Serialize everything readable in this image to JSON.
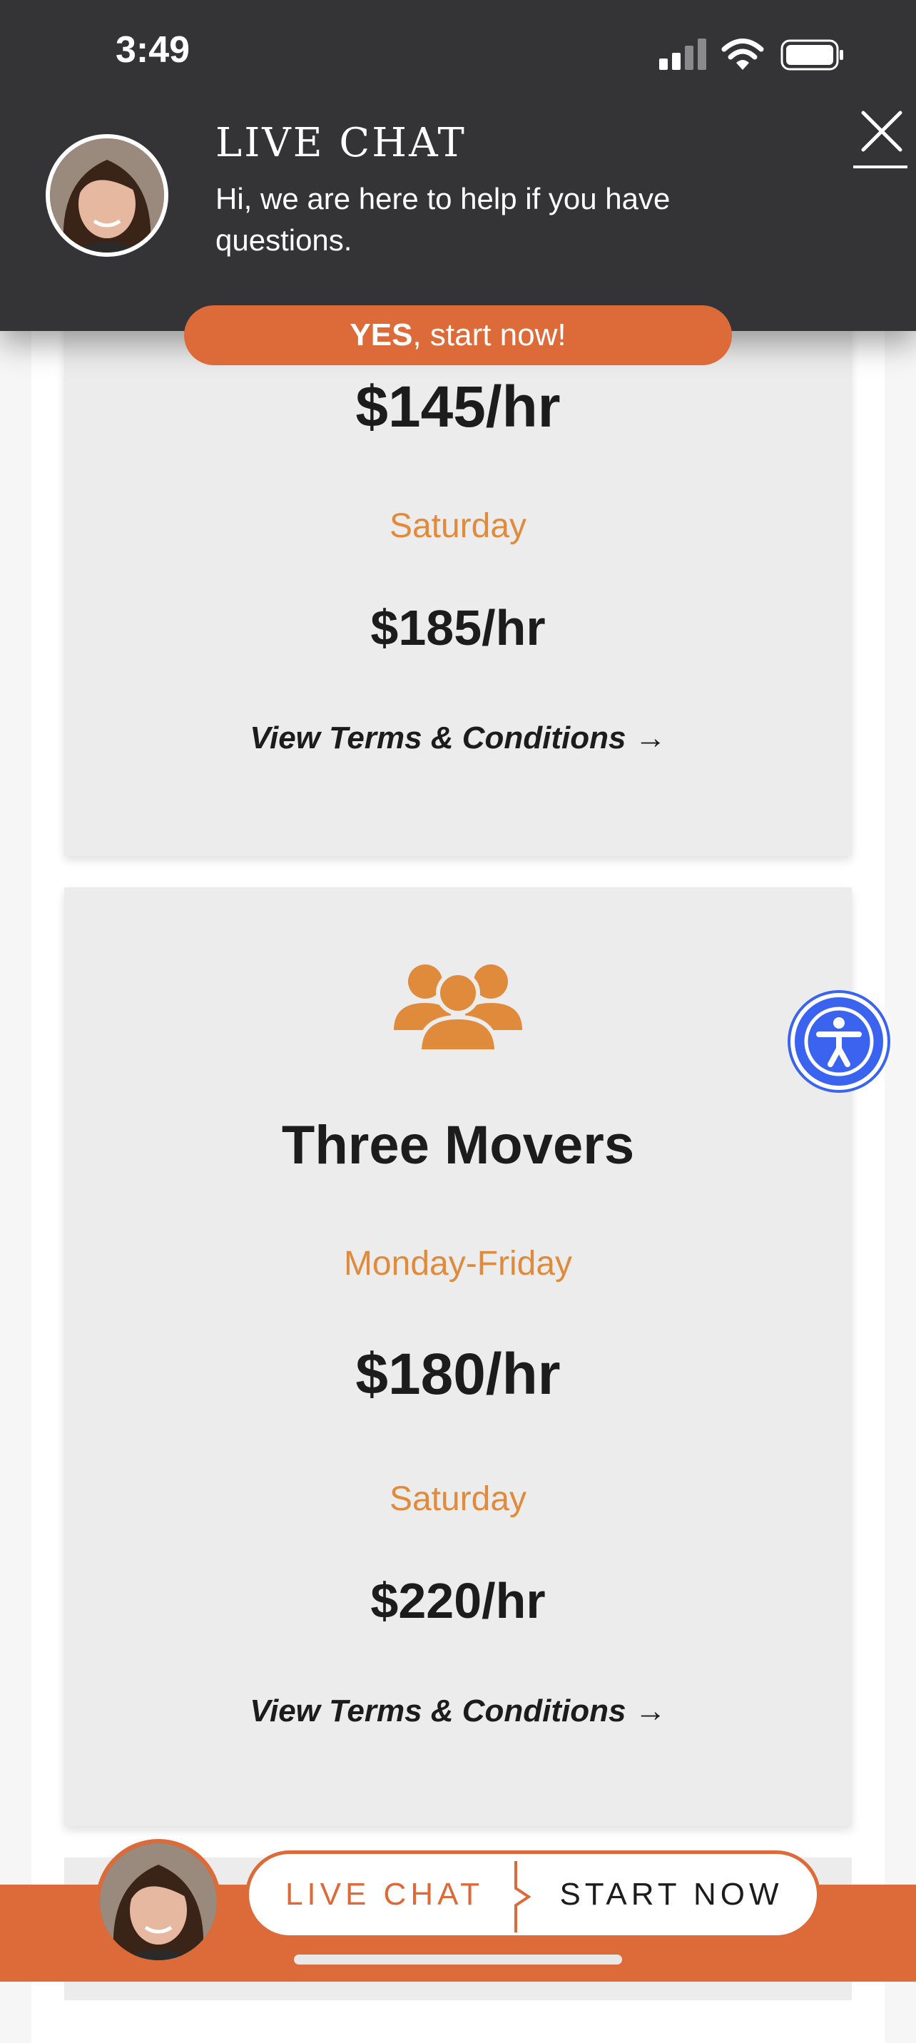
{
  "status_bar": {
    "time": "3:49"
  },
  "chat_banner": {
    "title": "LIVE CHAT",
    "message": "Hi, we are here to help if you have questions.",
    "cta_bold": "YES",
    "cta_rest": ", start now!"
  },
  "cards": [
    {
      "price_weekday": "$145/hr",
      "saturday_label": "Saturday",
      "price_saturday": "$185/hr",
      "terms_link": "View Terms & Conditions →"
    },
    {
      "icon": "people-group-icon",
      "title": "Three Movers",
      "weekday_label": "Monday-Friday",
      "price_weekday": "$180/hr",
      "saturday_label": "Saturday",
      "price_saturday": "$220/hr",
      "terms_link": "View Terms & Conditions →"
    }
  ],
  "bottom_bar": {
    "live_chat_label": "LIVE CHAT",
    "start_now_label": "START NOW"
  },
  "colors": {
    "accent_orange": "#dc6b39",
    "label_orange": "#e08a3c",
    "banner_dark": "#343436",
    "accessibility_blue": "#3a63f0"
  }
}
